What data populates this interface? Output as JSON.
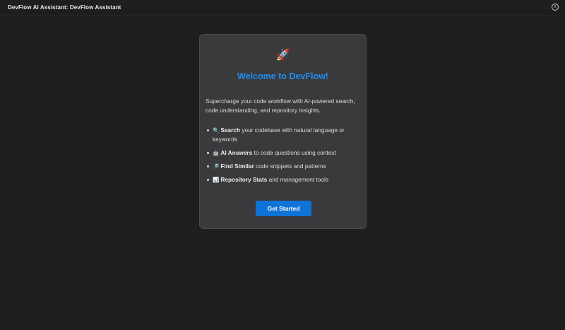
{
  "window": {
    "title": "DevFlow AI Assistant: DevFlow Assistant",
    "info_icon": "info-icon"
  },
  "welcome_card": {
    "icon": "rocket",
    "icon_glyph": "🚀",
    "heading": "Welcome to DevFlow!",
    "intro": "Supercharge your code workflow with AI-powered search, code understanding, and repository insights.",
    "features": [
      {
        "icon": "magnifier-icon",
        "glyph": "🔍",
        "bold": "Search",
        "rest": " your codebase with natural language or keywords"
      },
      {
        "icon": "robot-icon",
        "glyph": "🤖",
        "bold": "AI Answers",
        "rest": " to code questions using context"
      },
      {
        "icon": "magnifier-icon",
        "glyph": "🔎",
        "bold": "Find Similar",
        "rest": " code snippets and patterns"
      },
      {
        "icon": "chart-icon",
        "glyph": "📊",
        "bold": "Repository Stats",
        "rest": " and management tools"
      }
    ],
    "cta_label": "Get Started"
  },
  "colors": {
    "background": "#1e1e1e",
    "card": "#3a3a3d",
    "accent": "#1e8ef2",
    "button": "#0e72d6"
  }
}
